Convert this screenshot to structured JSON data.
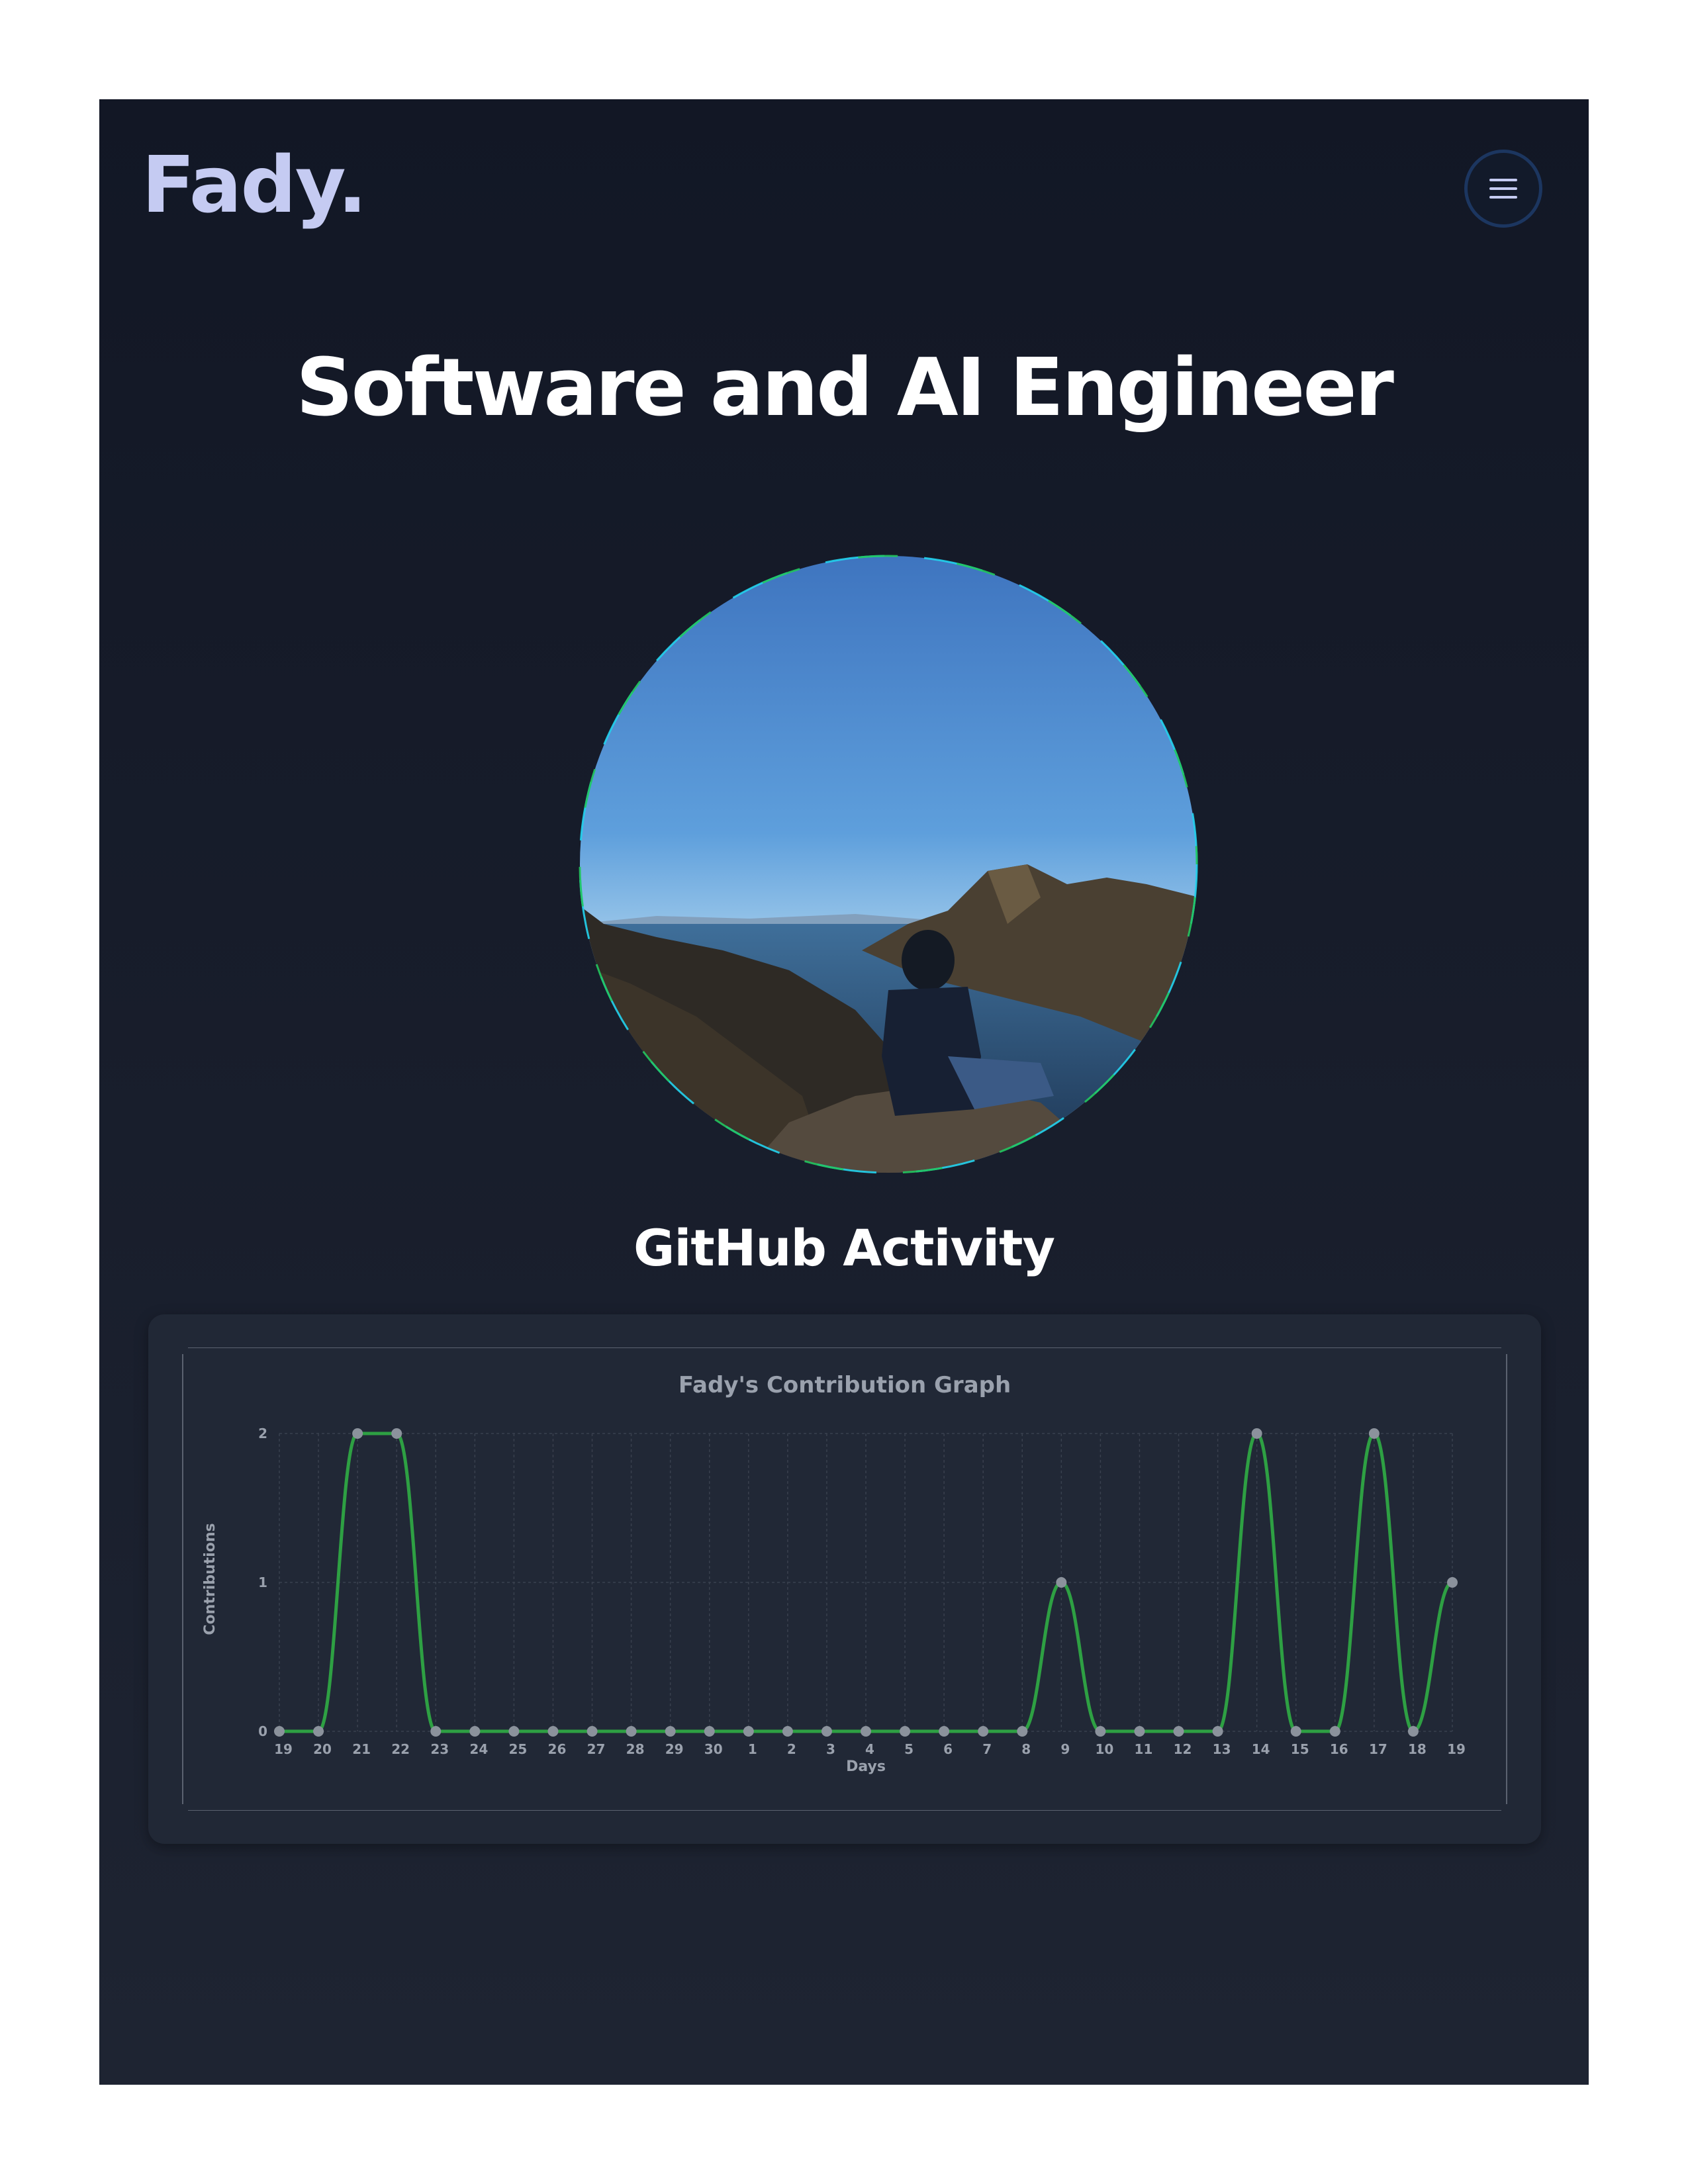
{
  "header": {
    "logo": "Fady.",
    "menu_icon": "hamburger-menu-icon"
  },
  "hero": {
    "title": "Software and AI Engineer",
    "avatar_desc_icon": "profile-photo"
  },
  "activity": {
    "section_title": "GitHub Activity"
  },
  "colors": {
    "line": "#2ea043",
    "point": "#8b929c",
    "grid": "#39404e",
    "ring_green": "#22c55e",
    "ring_cyan": "#22d3ee"
  },
  "chart_data": {
    "type": "line",
    "title": "Fady's Contribution Graph",
    "xlabel": "Days",
    "ylabel": "Contributions",
    "categories": [
      "19",
      "20",
      "21",
      "22",
      "23",
      "24",
      "25",
      "26",
      "27",
      "28",
      "29",
      "30",
      "1",
      "2",
      "3",
      "4",
      "5",
      "6",
      "7",
      "8",
      "9",
      "10",
      "11",
      "12",
      "13",
      "14",
      "15",
      "16",
      "17",
      "18",
      "19"
    ],
    "series": [
      {
        "values": [
          0,
          0,
          2,
          2,
          0,
          0,
          0,
          0,
          0,
          0,
          0,
          0,
          0,
          0,
          0,
          0,
          0,
          0,
          0,
          0,
          1,
          0,
          0,
          0,
          0,
          2,
          0,
          0,
          2,
          0,
          1
        ]
      }
    ],
    "y_ticks": [
      0,
      1,
      2
    ],
    "ylim": [
      0,
      2
    ],
    "grid": true,
    "legend": "none"
  }
}
